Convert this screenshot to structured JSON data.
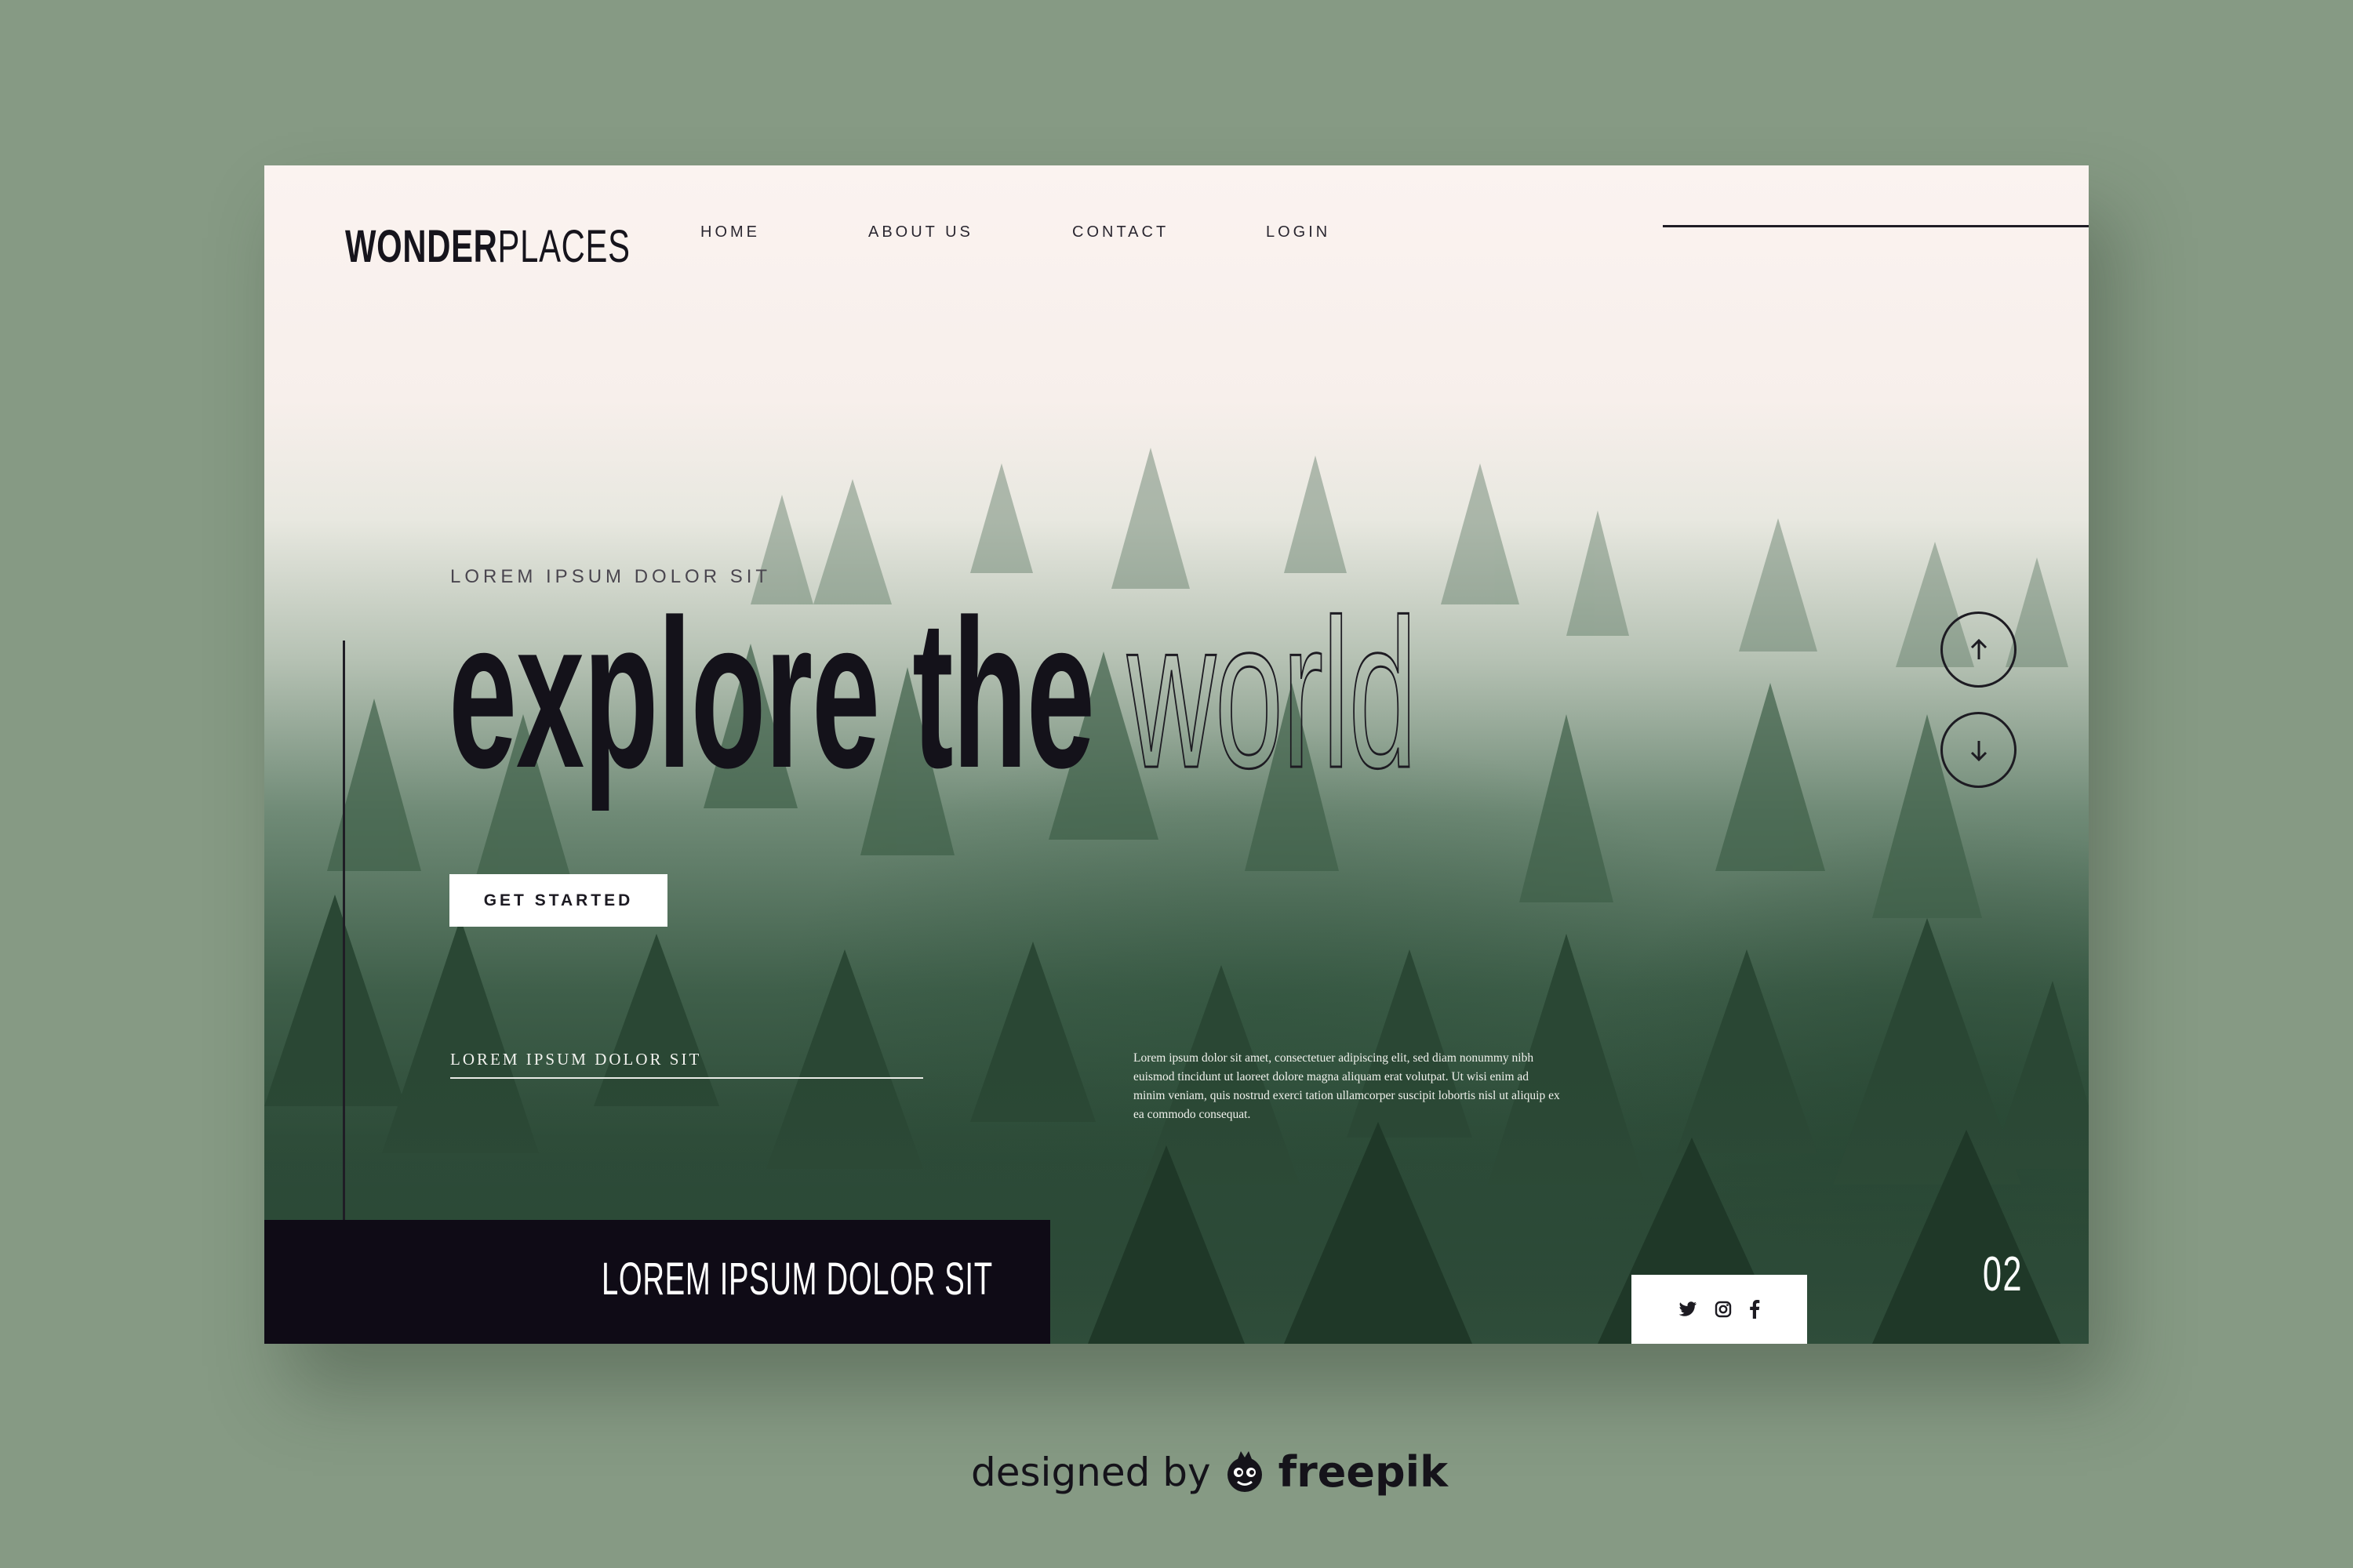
{
  "brand": {
    "name_bold": "WONDER",
    "name_thin": "PLACES"
  },
  "nav": {
    "items": [
      "HOME",
      "ABOUT US",
      "CONTACT",
      "LOGIN"
    ]
  },
  "hero": {
    "kicker": "LOREM IPSUM DOLOR SIT",
    "headline_solid": "explore the",
    "headline_outline": "world",
    "cta_label": "GET STARTED",
    "sub_label": "LOREM IPSUM DOLOR SIT",
    "paragraph": "Lorem ipsum dolor sit amet, consectetuer adipiscing elit, sed diam nonummy nibh euismod tincidunt ut laoreet dolore magna aliquam erat volutpat. Ut wisi enim ad minim veniam, quis nostrud exerci tation ullamcorper suscipit lobortis nisl ut aliquip ex ea commodo consequat."
  },
  "footer_bar": {
    "text": "LOREM IPSUM DOLOR SIT"
  },
  "slider": {
    "page_number": "02"
  },
  "social": {
    "icons": [
      "twitter-icon",
      "instagram-icon",
      "facebook-icon"
    ]
  },
  "credit": {
    "prefix": "designed by",
    "brand": "freepik"
  },
  "colors": {
    "background": "#869a84",
    "dark": "#0f0b16",
    "white": "#ffffff"
  }
}
